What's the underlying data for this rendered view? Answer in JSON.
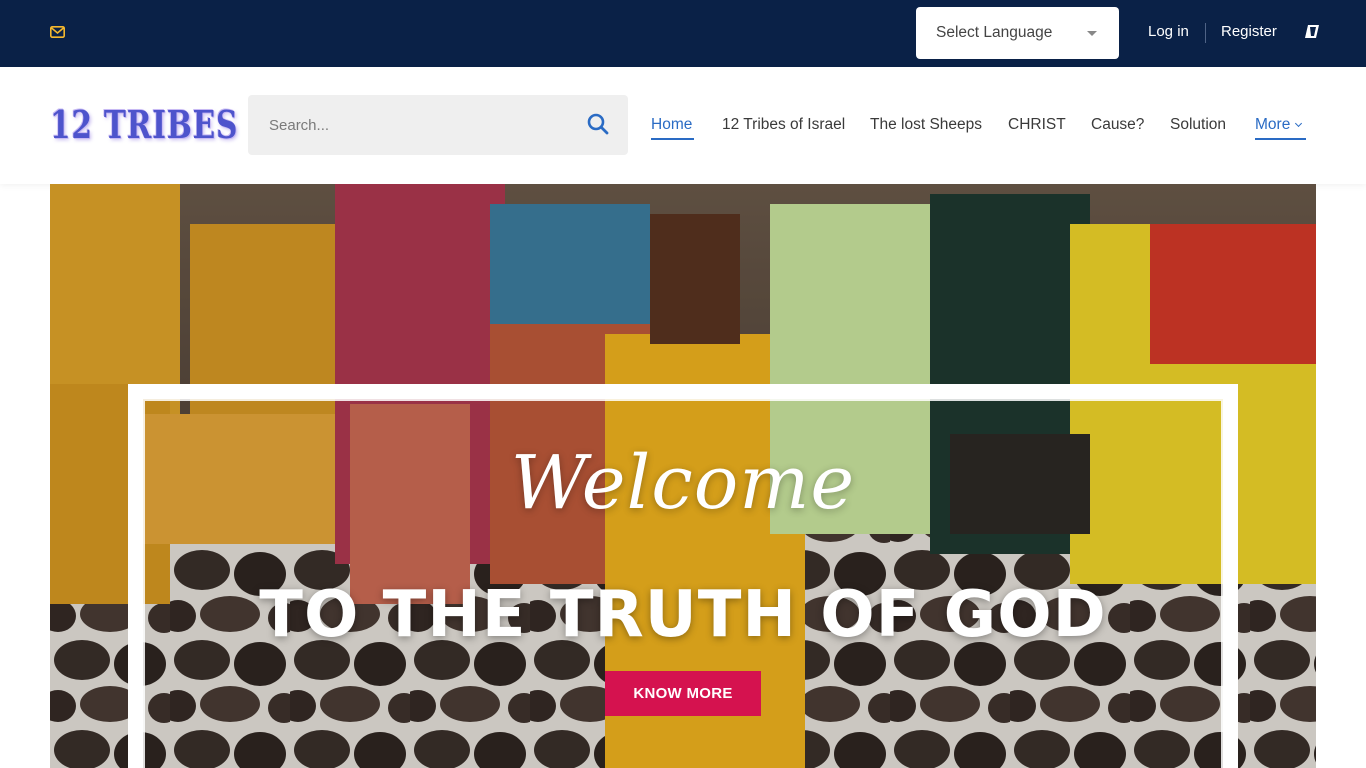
{
  "topbar": {
    "mail_icon": "mail-icon",
    "language_select": {
      "selected": "Select Language"
    },
    "login_label": "Log in",
    "register_label": "Register",
    "right_icon": "flag-icon",
    "colors": {
      "background": "#0a2147",
      "icon_accent": "#f5b82e"
    }
  },
  "header": {
    "logo_text": "12 TRIBES",
    "search": {
      "placeholder": "Search...",
      "value": ""
    },
    "nav": [
      {
        "label": "Home",
        "active": true
      },
      {
        "label": "12 Tribes of Israel",
        "active": false
      },
      {
        "label": "The lost Sheeps",
        "active": false
      },
      {
        "label": "CHRIST",
        "active": false
      },
      {
        "label": "Cause?",
        "active": false
      },
      {
        "label": "Solution",
        "active": false
      },
      {
        "label": "More",
        "active": false
      }
    ],
    "colors": {
      "nav_active": "#2a6bc4",
      "search_bg": "#efefef"
    }
  },
  "hero": {
    "script_text": "Welcome",
    "title": "TO THE TRUTH OF GOD",
    "button_label": "KNOW MORE",
    "colors": {
      "button": "#d5124f"
    }
  }
}
